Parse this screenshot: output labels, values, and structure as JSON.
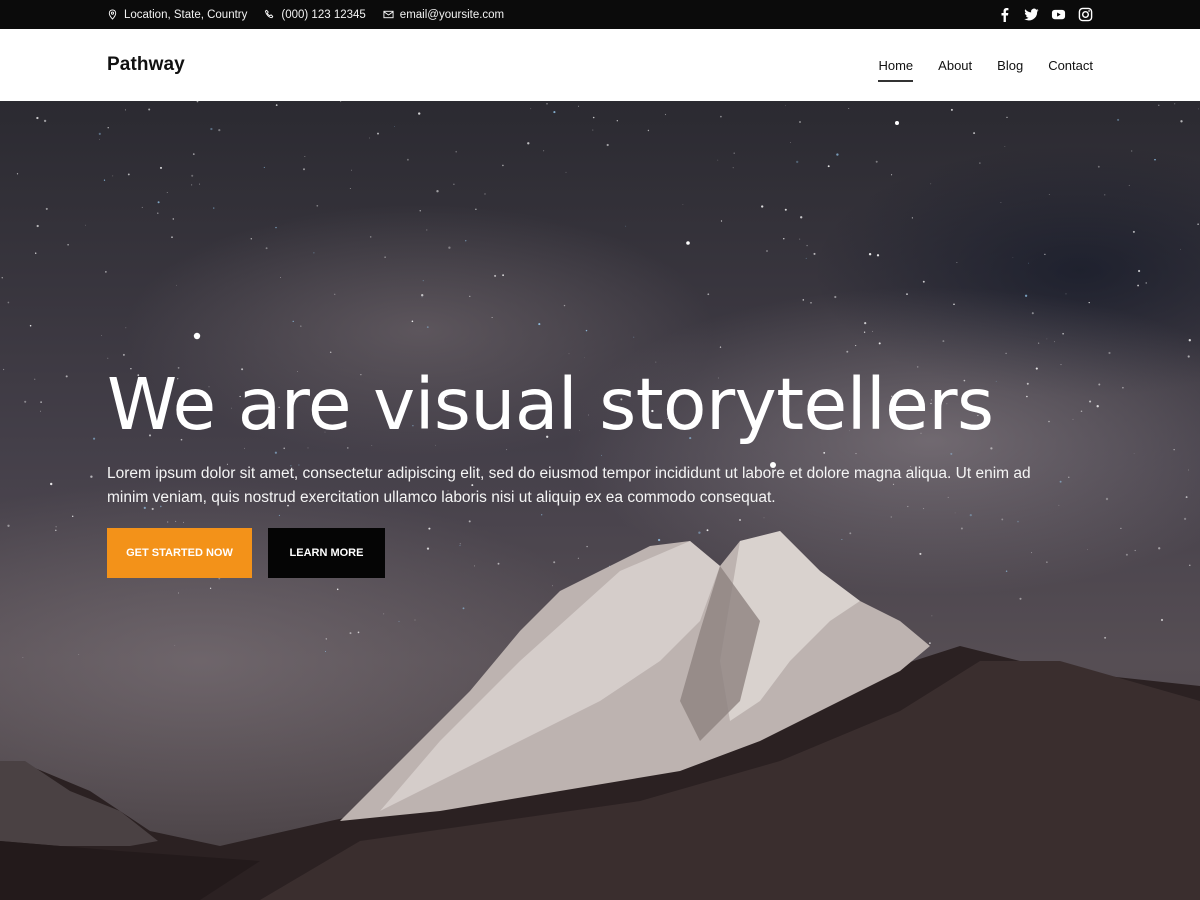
{
  "topbar": {
    "location": "Location, State, Country",
    "phone": "(000) 123 12345",
    "email": "email@yoursite.com",
    "social": [
      "facebook-icon",
      "twitter-icon",
      "youtube-icon",
      "instagram-icon"
    ]
  },
  "header": {
    "logo": "Pathway",
    "nav": [
      "Home",
      "About",
      "Blog",
      "Contact"
    ],
    "active_nav": "Home"
  },
  "hero": {
    "title": "We are visual storytellers",
    "text": "Lorem ipsum dolor sit amet, consectetur adipiscing elit, sed do eiusmod tempor incididunt ut labore et dolore magna aliqua. Ut enim ad minim veniam, quis nostrud exercitation ullamco laboris nisi ut aliquip ex ea commodo consequat.",
    "primary_button": "GET STARTED NOW",
    "secondary_button": "LEARN MORE"
  },
  "colors": {
    "accent": "#f39219",
    "topbar_bg": "#0b0b0b",
    "dark_button": "#050505"
  }
}
